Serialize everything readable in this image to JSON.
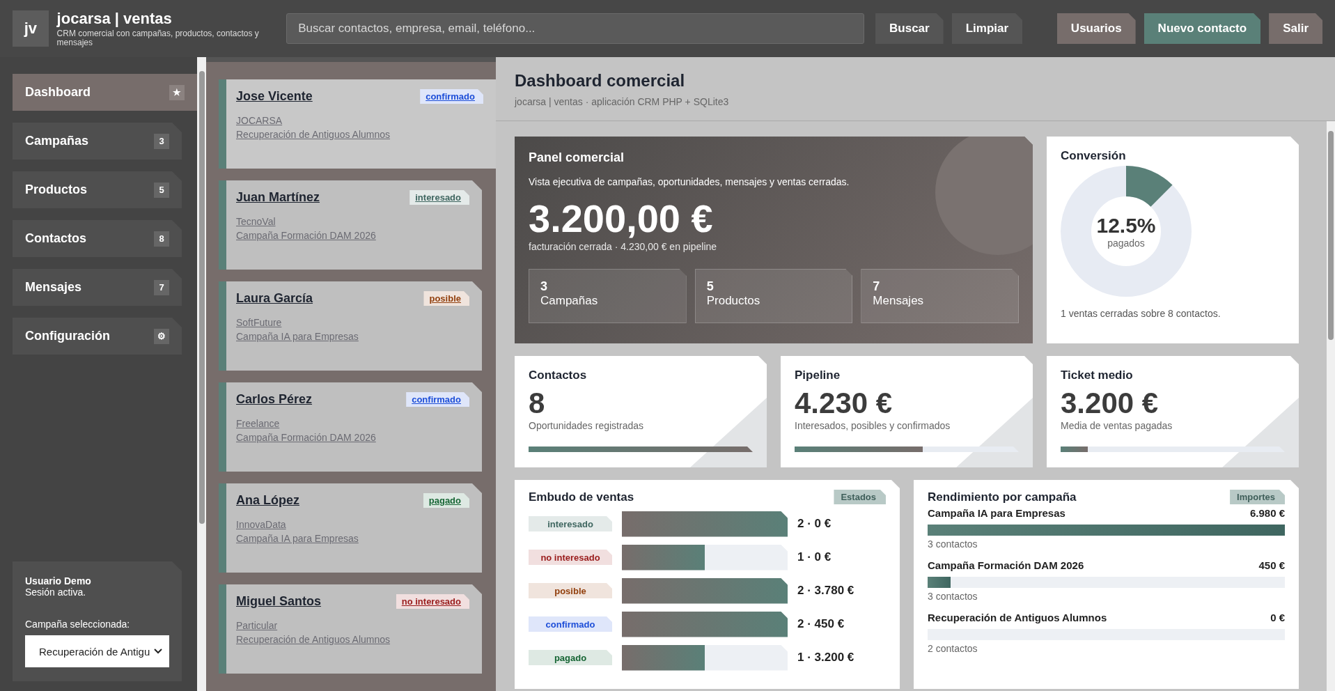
{
  "header": {
    "logo": "jv",
    "title": "jocarsa | ventas",
    "subtitle": "CRM comercial con campañas, productos, contactos y mensajes",
    "search": {
      "placeholder": "Buscar contactos, empresa, email, teléfono..."
    },
    "buttons": [
      {
        "label": "Buscar",
        "kind": "dark"
      },
      {
        "label": "Limpiar",
        "kind": "dark"
      },
      {
        "label": "Usuarios",
        "kind": "muted"
      },
      {
        "label": "Nuevo contacto",
        "kind": "primary"
      },
      {
        "label": "Salir",
        "kind": "muted"
      }
    ]
  },
  "sidebar": {
    "items": [
      {
        "label": "Dashboard",
        "badge": "★",
        "selected": true
      },
      {
        "label": "Campañas",
        "badge": "3",
        "selected": false
      },
      {
        "label": "Productos",
        "badge": "5",
        "selected": false
      },
      {
        "label": "Contactos",
        "badge": "8",
        "selected": false
      },
      {
        "label": "Mensajes",
        "badge": "7",
        "selected": false
      },
      {
        "label": "Configuración",
        "badge": "⚙",
        "selected": false
      }
    ],
    "user": {
      "name": "Usuario Demo",
      "status": "Sesión activa.",
      "campaign_label": "Campaña seleccionada:",
      "campaign_value": "Recuperación de Antigu"
    }
  },
  "contacts": [
    {
      "name": "Jose Vicente",
      "status": "confirmado",
      "color": "#1d4ed8",
      "company": "JOCARSA",
      "campaign": "Recuperación de Antiguos Alumnos",
      "selected": true
    },
    {
      "name": "Juan Martínez",
      "status": "interesado",
      "color": "#3f6660",
      "company": "TecnoVal",
      "campaign": "Campaña Formación DAM 2026",
      "selected": false
    },
    {
      "name": "Laura García",
      "status": "posible",
      "color": "#92400e",
      "company": "SoftFuture",
      "campaign": "Campaña IA para Empresas",
      "selected": false
    },
    {
      "name": "Carlos Pérez",
      "status": "confirmado",
      "color": "#1d4ed8",
      "company": "Freelance",
      "campaign": "Campaña Formación DAM 2026",
      "selected": false
    },
    {
      "name": "Ana López",
      "status": "pagado",
      "color": "#166534",
      "company": "InnovaData",
      "campaign": "Campaña IA para Empresas",
      "selected": false
    },
    {
      "name": "Miguel Santos",
      "status": "no interesado",
      "color": "#991b1b",
      "company": "Particular",
      "campaign": "Recuperación de Antiguos Alumnos",
      "selected": false
    }
  ],
  "page": {
    "title": "Dashboard comercial",
    "subtitle": "jocarsa | ventas · aplicación CRM PHP + SQLite3"
  },
  "hero": {
    "title": "Panel comercial",
    "description": "Vista ejecutiva de campañas, oportunidades, mensajes y ventas cerradas.",
    "amount": "3.200,00 €",
    "note": "facturación cerrada · 4.230,00 € en pipeline",
    "stats": [
      {
        "value": "3",
        "label": "Campañas"
      },
      {
        "value": "5",
        "label": "Productos"
      },
      {
        "value": "7",
        "label": "Mensajes"
      }
    ]
  },
  "conversion": {
    "title": "Conversión",
    "percent": "12.5%",
    "caption": "pagados",
    "level": 0.125,
    "note": "1 ventas cerradas sobre 8 contactos."
  },
  "kpis": [
    {
      "title": "Contactos",
      "value": "8",
      "caption": "Oportunidades registradas",
      "level": 1
    },
    {
      "title": "Pipeline",
      "value": "4.230 €",
      "caption": "Interesados, posibles y confirmados",
      "level": 0.57
    },
    {
      "title": "Ticket medio",
      "value": "3.200 €",
      "caption": "Media de ventas pagadas",
      "level": 0.12
    }
  ],
  "funnel": {
    "title": "Embudo de ventas",
    "tag": "Estados",
    "rows": [
      {
        "status": "interesado",
        "color": "#3f6660",
        "level": 1,
        "reading": "2 · 0 €"
      },
      {
        "status": "no interesado",
        "color": "#991b1b",
        "level": 0.5,
        "reading": "1 · 0 €"
      },
      {
        "status": "posible",
        "color": "#92400e",
        "level": 1,
        "reading": "2 · 3.780 €"
      },
      {
        "status": "confirmado",
        "color": "#1d4ed8",
        "level": 1,
        "reading": "2 · 450 €"
      },
      {
        "status": "pagado",
        "color": "#166534",
        "level": 0.5,
        "reading": "1 · 3.200 €"
      }
    ]
  },
  "campaigns": {
    "title": "Rendimiento por campaña",
    "tag": "Importes",
    "rows": [
      {
        "name": "Campaña IA para Empresas",
        "amount": "6.980 €",
        "level": 1,
        "contacts": "3 contactos"
      },
      {
        "name": "Campaña Formación DAM 2026",
        "amount": "450 €",
        "level": 0.065,
        "contacts": "3 contactos"
      },
      {
        "name": "Recuperación de Antiguos Alumnos",
        "amount": "0 €",
        "level": 0,
        "contacts": "2 contactos"
      }
    ]
  }
}
